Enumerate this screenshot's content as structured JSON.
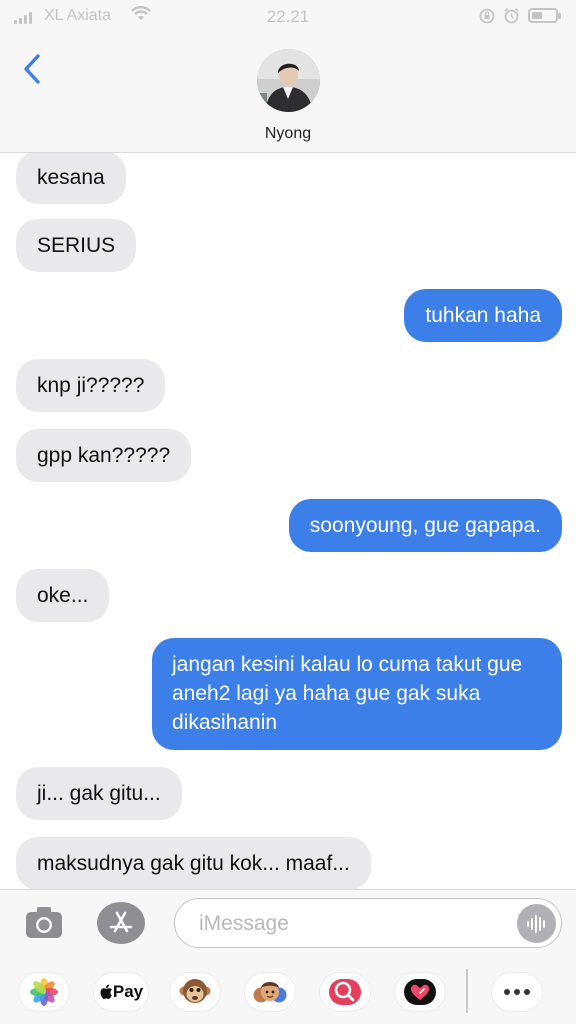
{
  "status_bar": {
    "carrier": "XL Axiata",
    "time": "22.21",
    "battery_level": 0.45
  },
  "header": {
    "contact_name": "Nyong",
    "back_icon": "chevron-left-icon"
  },
  "messages": [
    {
      "direction": "received",
      "text": "kesana"
    },
    {
      "direction": "received",
      "text": "SERIUS"
    },
    {
      "direction": "sent",
      "text": "tuhkan haha"
    },
    {
      "direction": "received",
      "text": "knp ji?????"
    },
    {
      "direction": "received",
      "text": "gpp kan?????"
    },
    {
      "direction": "sent",
      "text": "soonyoung, gue gapapa."
    },
    {
      "direction": "received",
      "text": "oke..."
    },
    {
      "direction": "sent",
      "text": "jangan kesini kalau lo cuma takut gue aneh2 lagi ya haha gue gak suka dikasihanin"
    },
    {
      "direction": "received",
      "text": "ji... gak gitu..."
    },
    {
      "direction": "received",
      "text": "maksudnya gak gitu kok... maaf..."
    }
  ],
  "input_bar": {
    "placeholder": "iMessage",
    "camera_icon": "camera-icon",
    "appstore_icon": "app-store-icon",
    "audio_icon": "audio-waveform-icon"
  },
  "app_tray": {
    "apple_pay_label": "Pay",
    "apps": [
      "photos-icon",
      "apple-pay-icon",
      "monkey-memoji-icon",
      "memoji-stickers-icon",
      "web-images-search-icon",
      "digital-touch-heart-icon",
      "more-icon"
    ]
  },
  "colors": {
    "sent_bubble": "#3d7fe8",
    "received_bubble": "#e9e9eb",
    "back_chevron": "#3d7fe8"
  }
}
